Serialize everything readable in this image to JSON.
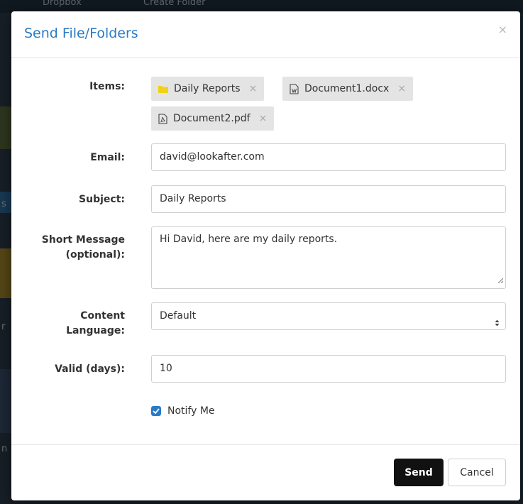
{
  "background": {
    "crumbs": [
      "Dropbox",
      "Create Folder"
    ],
    "side_letters": [
      "s",
      "r",
      "n"
    ]
  },
  "modal": {
    "title": "Send File/Folders",
    "close_glyph": "×"
  },
  "form": {
    "items_label": "Items:",
    "items": [
      {
        "name": "Daily Reports",
        "icon": "folder-icon",
        "remove": "×"
      },
      {
        "name": "Document1.docx",
        "icon": "word-document-icon",
        "remove": "×"
      },
      {
        "name": "Document2.pdf",
        "icon": "pdf-document-icon",
        "remove": "×"
      }
    ],
    "email_label": "Email:",
    "email_value": "david@lookafter.com",
    "subject_label": "Subject:",
    "subject_value": "Daily Reports",
    "message_label_line1": "Short Message",
    "message_label_line2": "(optional):",
    "message_value": "Hi David, here are my daily reports.",
    "language_label_line1": "Content",
    "language_label_line2": "Language:",
    "language_value": "Default",
    "valid_label": "Valid (days):",
    "valid_value": "10",
    "notify_label": "Notify Me",
    "notify_checked": true
  },
  "footer": {
    "send_label": "Send",
    "cancel_label": "Cancel"
  },
  "colors": {
    "title": "#2a7bc7",
    "folder": "#f2d11a",
    "send_bg": "#111111"
  }
}
